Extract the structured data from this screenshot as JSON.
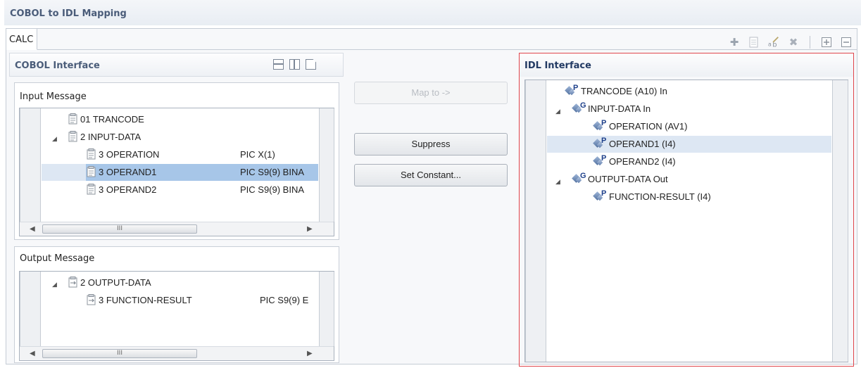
{
  "window": {
    "title": "COBOL to IDL Mapping"
  },
  "tab": {
    "label": "CALC"
  },
  "toolbar": {
    "icons": [
      "add-icon",
      "copy-icon",
      "rename-icon",
      "delete-icon",
      "expand-all-icon",
      "collapse-all-icon"
    ]
  },
  "cobol": {
    "title": "COBOL Interface",
    "view_icons": [
      "horizontal-split-icon",
      "vertical-split-icon",
      "single-page-icon"
    ],
    "input": {
      "label": "Input Message",
      "rows": [
        {
          "name": "01 TRANCODE",
          "pic": ""
        },
        {
          "name": "2 INPUT-DATA",
          "pic": ""
        },
        {
          "name": "3 OPERATION",
          "pic": "PIC X(1)"
        },
        {
          "name": "3 OPERAND1",
          "pic": "PIC S9(9) BINA"
        },
        {
          "name": "3 OPERAND2",
          "pic": "PIC S9(9) BINA"
        }
      ],
      "scroll_mark": "III"
    },
    "output": {
      "label": "Output Message",
      "rows": [
        {
          "name": "2 OUTPUT-DATA",
          "pic": ""
        },
        {
          "name": "3 FUNCTION-RESULT",
          "pic": "PIC S9(9) E"
        }
      ],
      "scroll_mark": "III"
    }
  },
  "buttons": {
    "map_to": "Map to ->",
    "suppress": "Suppress",
    "set_constant": "Set Constant..."
  },
  "idl": {
    "title": "IDL Interface",
    "rows": [
      {
        "sup": "P",
        "text": "TRANCODE  (A10)  In"
      },
      {
        "sup": "G",
        "text": "INPUT-DATA  In"
      },
      {
        "sup": "P",
        "text": "OPERATION  (AV1)"
      },
      {
        "sup": "P",
        "text": "OPERAND1  (I4)"
      },
      {
        "sup": "P",
        "text": "OPERAND2  (I4)"
      },
      {
        "sup": "G",
        "text": "OUTPUT-DATA  Out"
      },
      {
        "sup": "P",
        "text": "FUNCTION-RESULT  (I4)"
      }
    ]
  },
  "colors": {
    "selection": "#a7c6e8",
    "highlight": "#dde7f3",
    "idl_border": "#e0454c",
    "title_text": "#4a5c79"
  }
}
